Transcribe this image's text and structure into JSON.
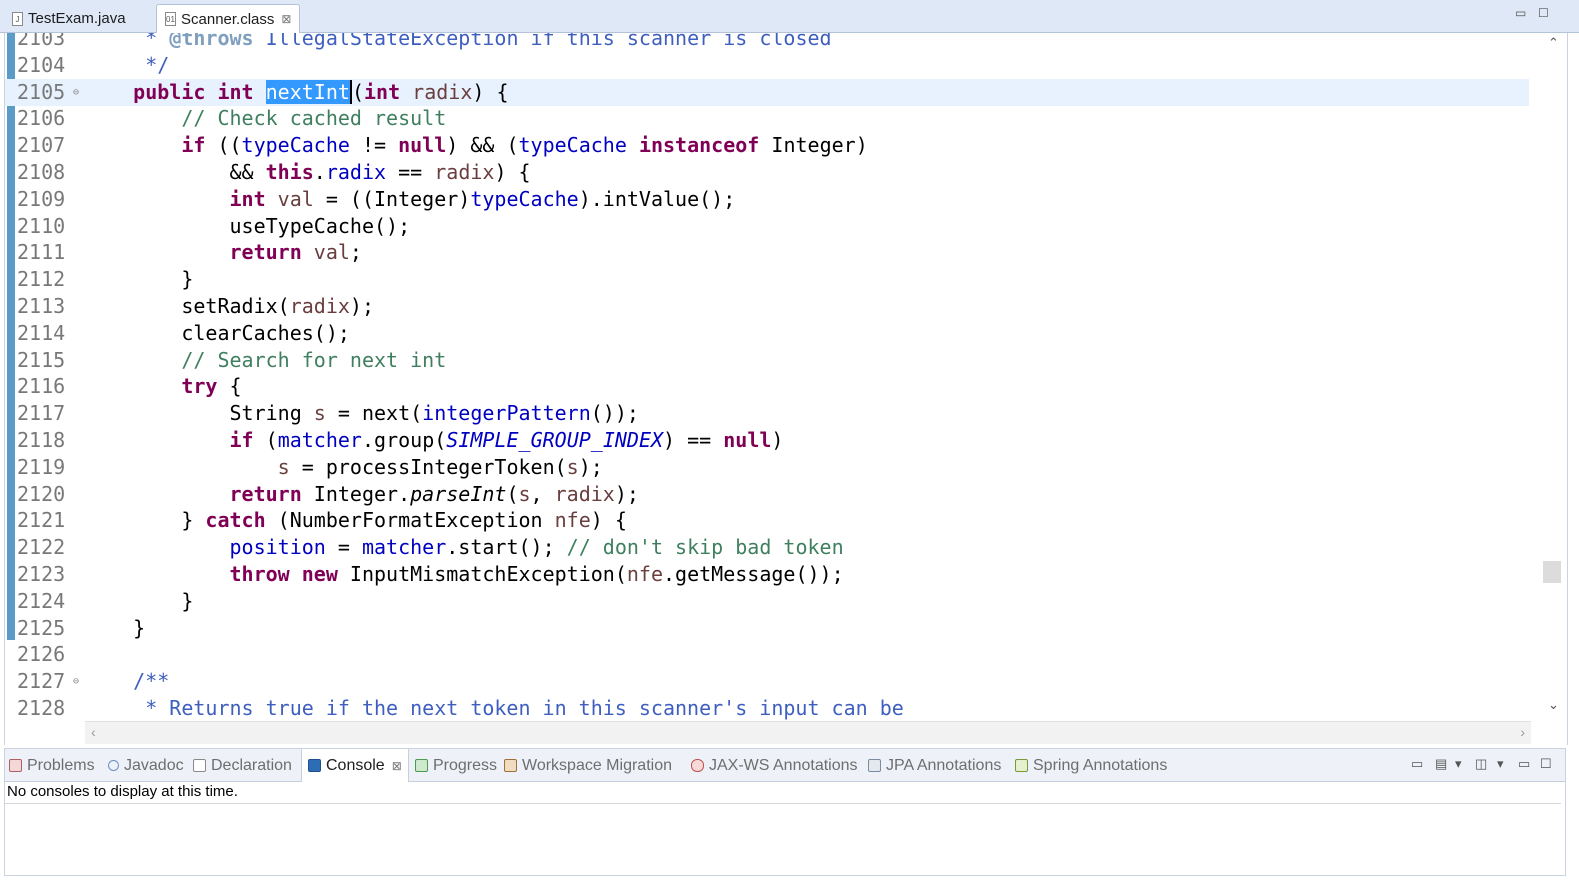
{
  "editor_tabs": [
    {
      "label": "TestExam.java",
      "icon": "java-file-icon",
      "active": false
    },
    {
      "label": "Scanner.class",
      "icon": "class-file-icon",
      "active": true,
      "close": "⊠"
    }
  ],
  "window_controls": {
    "minimize": "▭",
    "maximize": "☐"
  },
  "code": {
    "lines": [
      {
        "num": "2103",
        "fold": false,
        "html": "<span class=\"jdoc\">     * </span><span class=\"jtag\">@throws</span><span class=\"jdoc\"> IllegalStateException if this scanner is closed</span>"
      },
      {
        "num": "2104",
        "fold": false,
        "html": "<span class=\"jdoc\">     */</span>"
      },
      {
        "num": "2105",
        "fold": true,
        "current": true,
        "html": "    <span class=\"kw\">public</span> <span class=\"kw\">int</span> <span class=\"sel caret\">nextInt</span>(<span class=\"kw\">int</span> <span class=\"var\">radix</span>) {"
      },
      {
        "num": "2106",
        "fold": false,
        "html": "        <span class=\"cmt\">// Check cached result</span>"
      },
      {
        "num": "2107",
        "fold": false,
        "html": "        <span class=\"kw\">if</span> ((<span class=\"fld\">typeCache</span> != <span class=\"kw\">null</span>) &amp;&amp; (<span class=\"fld\">typeCache</span> <span class=\"kw\">instanceof</span> Integer)"
      },
      {
        "num": "2108",
        "fold": false,
        "html": "            &amp;&amp; <span class=\"kw\">this</span>.<span class=\"fld\">radix</span> == <span class=\"var\">radix</span>) {"
      },
      {
        "num": "2109",
        "fold": false,
        "html": "            <span class=\"kw\">int</span> <span class=\"var\">val</span> = ((Integer)<span class=\"fld\">typeCache</span>).intValue();"
      },
      {
        "num": "2110",
        "fold": false,
        "html": "            useTypeCache();"
      },
      {
        "num": "2111",
        "fold": false,
        "html": "            <span class=\"kw\">return</span> <span class=\"var\">val</span>;"
      },
      {
        "num": "2112",
        "fold": false,
        "html": "        }"
      },
      {
        "num": "2113",
        "fold": false,
        "html": "        setRadix(<span class=\"var\">radix</span>);"
      },
      {
        "num": "2114",
        "fold": false,
        "html": "        clearCaches();"
      },
      {
        "num": "2115",
        "fold": false,
        "html": "        <span class=\"cmt\">// Search for next int</span>"
      },
      {
        "num": "2116",
        "fold": false,
        "html": "        <span class=\"kw\">try</span> {"
      },
      {
        "num": "2117",
        "fold": false,
        "html": "            String <span class=\"var\">s</span> = next(<span class=\"fld\">integerPattern</span>());"
      },
      {
        "num": "2118",
        "fold": false,
        "html": "            <span class=\"kw\">if</span> (<span class=\"fld\">matcher</span>.group(<span class=\"sfld\">SIMPLE_GROUP_INDEX</span>) == <span class=\"kw\">null</span>)"
      },
      {
        "num": "2119",
        "fold": false,
        "html": "                <span class=\"var\">s</span> = processIntegerToken(<span class=\"var\">s</span>);"
      },
      {
        "num": "2120",
        "fold": false,
        "html": "            <span class=\"kw\">return</span> Integer.<span class=\"smeth\">parseInt</span>(<span class=\"var\">s</span>, <span class=\"var\">radix</span>);"
      },
      {
        "num": "2121",
        "fold": false,
        "html": "        } <span class=\"kw\">catch</span> (NumberFormatException <span class=\"var\">nfe</span>) {"
      },
      {
        "num": "2122",
        "fold": false,
        "html": "            <span class=\"fld\">position</span> = <span class=\"fld\">matcher</span>.start(); <span class=\"cmt\">// don't skip bad token</span>"
      },
      {
        "num": "2123",
        "fold": false,
        "html": "            <span class=\"kw\">throw</span> <span class=\"kw\">new</span> InputMismatchException(<span class=\"var\">nfe</span>.getMessage());"
      },
      {
        "num": "2124",
        "fold": false,
        "html": "        }"
      },
      {
        "num": "2125",
        "fold": false,
        "html": "    }"
      },
      {
        "num": "2126",
        "fold": false,
        "html": ""
      },
      {
        "num": "2127",
        "fold": true,
        "html": "<span class=\"jdoc\">    /**</span>"
      },
      {
        "num": "2128",
        "fold": false,
        "html": "<span class=\"jdoc\">     * Returns true if the next token in this scanner's input can be</span>"
      }
    ]
  },
  "scrollbar": {
    "up": "⌃",
    "down": "⌄",
    "left": "‹",
    "right": "›"
  },
  "view_tabs": [
    {
      "label": "Problems",
      "icon": "problems-icon",
      "active": false
    },
    {
      "label": "Javadoc",
      "icon": "javadoc-icon",
      "active": false
    },
    {
      "label": "Declaration",
      "icon": "declaration-icon",
      "active": false
    },
    {
      "label": "Console",
      "icon": "console-icon",
      "active": true,
      "close": "⊠"
    },
    {
      "label": "Progress",
      "icon": "progress-icon",
      "active": false
    },
    {
      "label": "Workspace Migration",
      "icon": "workspace-migration-icon",
      "active": false
    },
    {
      "label": "JAX-WS Annotations",
      "icon": "jax-ws-icon",
      "active": false
    },
    {
      "label": "JPA Annotations",
      "icon": "jpa-icon",
      "active": false
    },
    {
      "label": "Spring Annotations",
      "icon": "spring-icon",
      "active": false
    }
  ],
  "console": {
    "message": "No consoles to display at this time."
  },
  "colors": {
    "keyword": "#7f0055",
    "field": "#0000c0",
    "comment": "#3f7f5f",
    "javadoc": "#3f5fbf",
    "selection": "#3399ff",
    "current_line": "#e8f2fe"
  }
}
